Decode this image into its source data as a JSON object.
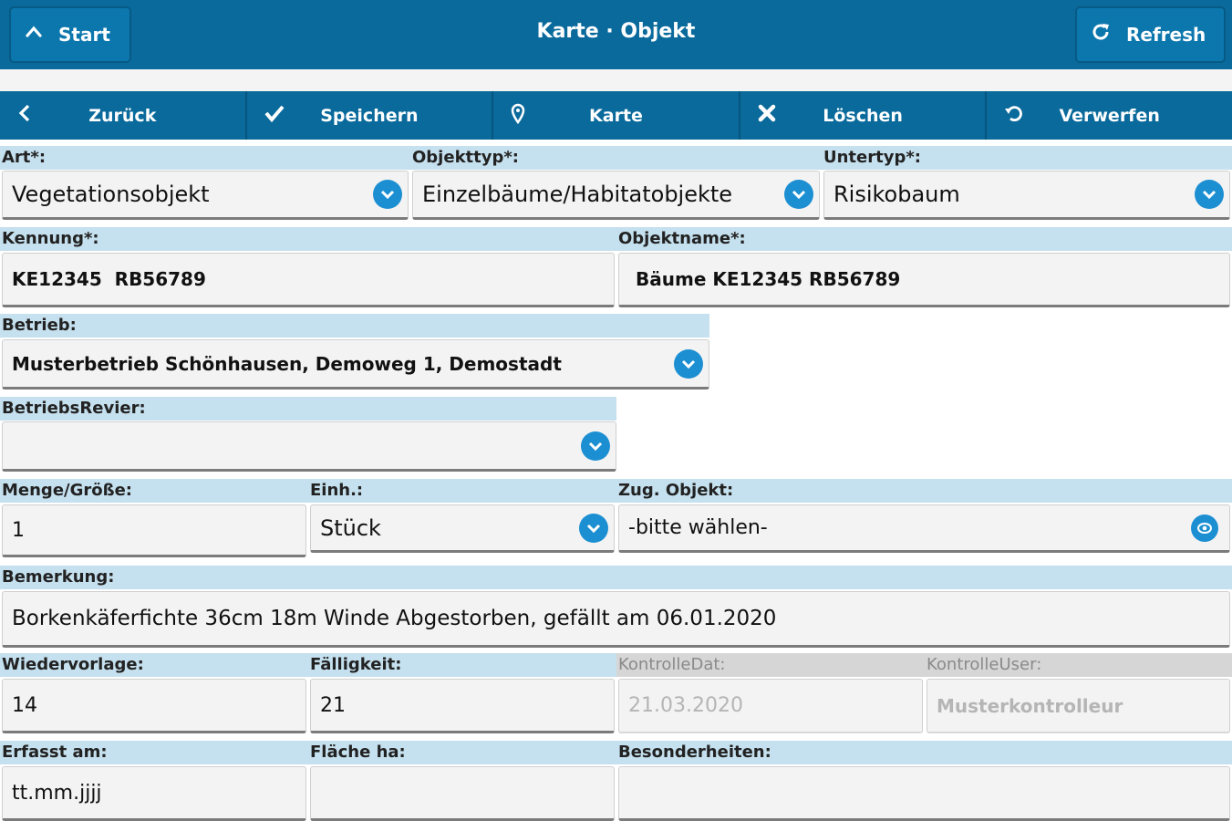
{
  "header": {
    "title": "Karte · Objekt",
    "start_label": "Start",
    "refresh_label": "Refresh"
  },
  "toolbar": {
    "back_label": "Zurück",
    "save_label": "Speichern",
    "map_label": "Karte",
    "delete_label": "Löschen",
    "discard_label": "Verwerfen"
  },
  "form": {
    "art": {
      "label": "Art*:",
      "value": "Vegetationsobjekt"
    },
    "objekttyp": {
      "label": "Objekttyp*:",
      "value": "Einzelbäume/Habitatobjekte"
    },
    "untertyp": {
      "label": "Untertyp*:",
      "value": "Risikobaum"
    },
    "kennung": {
      "label": "Kennung*:",
      "value": "KE12345  RB56789"
    },
    "objektname": {
      "label": "Objektname*:",
      "value": "Bäume KE12345 RB56789"
    },
    "betrieb": {
      "label": "Betrieb:",
      "value": "Musterbetrieb Schönhausen, Demoweg 1, Demostadt"
    },
    "betriebsrevier": {
      "label": "BetriebsRevier:",
      "value": ""
    },
    "menge": {
      "label": "Menge/Größe:",
      "value": "1"
    },
    "einheit": {
      "label": "Einh.:",
      "value": "Stück"
    },
    "zug_objekt": {
      "label": "Zug. Objekt:",
      "value": "-bitte wählen-"
    },
    "bemerkung": {
      "label": "Bemerkung:",
      "value": "Borkenkäferfichte 36cm 18m Winde Abgestorben, gefällt am 06.01.2020"
    },
    "wiedervorlage": {
      "label": "Wiedervorlage:",
      "value": "14"
    },
    "faelligkeit": {
      "label": "Fälligkeit:",
      "value": "21"
    },
    "kontrolledat": {
      "label": "KontrolleDat:",
      "value": "21.03.2020"
    },
    "kontrolleuser": {
      "label": "KontrolleUser:",
      "value": "Musterkontrolleur"
    },
    "erfasst": {
      "label": "Erfasst am:",
      "value": "tt.mm.jjjj"
    },
    "flaeche": {
      "label": "Fläche ha:",
      "value": ""
    },
    "besonderheiten": {
      "label": "Besonderheiten:",
      "value": ""
    }
  },
  "colors": {
    "header_bg": "#0a6a9c",
    "label_bg": "#c5e0ee",
    "accent": "#1c8fd2"
  }
}
